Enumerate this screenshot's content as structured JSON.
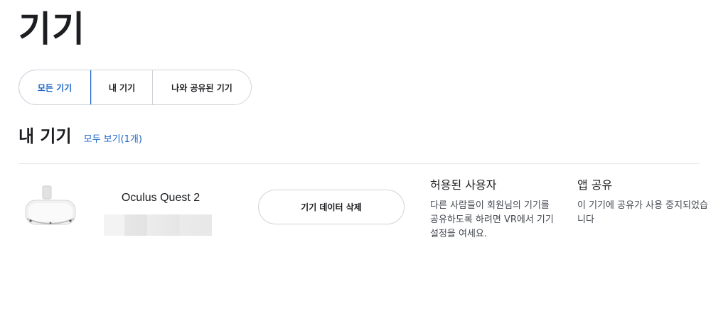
{
  "page": {
    "title": "기기"
  },
  "tabs": [
    {
      "label": "모든 기기",
      "active": true
    },
    {
      "label": "내 기기",
      "active": false
    },
    {
      "label": "나와 공유된 기기",
      "active": false
    }
  ],
  "section": {
    "title": "내 기기",
    "view_all": "모두 보기(1개)"
  },
  "device": {
    "name": "Oculus Quest 2",
    "delete_button": "기기 데이터 삭제",
    "allowed_users": {
      "title": "허용된 사용자",
      "text": "다른 사람들이 회원님의 기기를 공유하도록 하려면 VR에서 기기 설정을 여세요."
    },
    "app_sharing": {
      "title": "앱 공유",
      "text": "이 기기에 공유가 사용 중지되었습니다"
    }
  },
  "colors": {
    "accent": "#1b64c9",
    "border": "#cfd3d8",
    "text": "#1c1e21"
  }
}
